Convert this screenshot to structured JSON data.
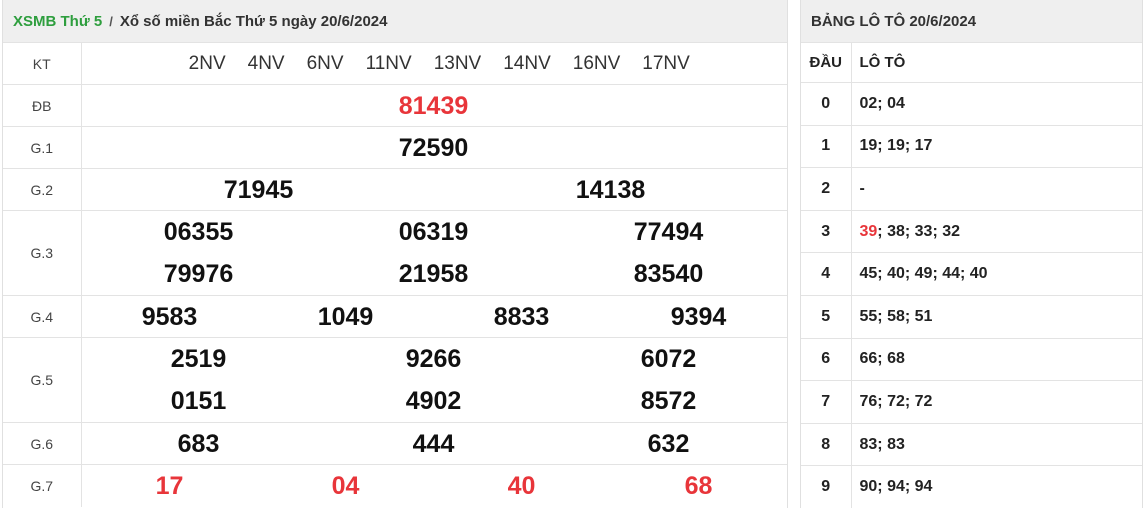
{
  "header": {
    "link_text": "XSMB Thứ 5",
    "separator": "/",
    "title": "Xổ số miền Bắc Thứ 5 ngày 20/6/2024"
  },
  "kt": {
    "label": "KT",
    "codes": [
      "2NV",
      "4NV",
      "6NV",
      "11NV",
      "13NV",
      "14NV",
      "16NV",
      "17NV"
    ]
  },
  "prizes": {
    "db": {
      "label": "ĐB",
      "numbers": [
        "81439"
      ]
    },
    "g1": {
      "label": "G.1",
      "numbers": [
        "72590"
      ]
    },
    "g2": {
      "label": "G.2",
      "numbers": [
        "71945",
        "14138"
      ]
    },
    "g3": {
      "label": "G.3",
      "numbers": [
        "06355",
        "06319",
        "77494",
        "79976",
        "21958",
        "83540"
      ]
    },
    "g4": {
      "label": "G.4",
      "numbers": [
        "9583",
        "1049",
        "8833",
        "9394"
      ]
    },
    "g5": {
      "label": "G.5",
      "numbers": [
        "2519",
        "9266",
        "6072",
        "0151",
        "4902",
        "8572"
      ]
    },
    "g6": {
      "label": "G.6",
      "numbers": [
        "683",
        "444",
        "632"
      ]
    },
    "g7": {
      "label": "G.7",
      "numbers": [
        "17",
        "04",
        "40",
        "68"
      ]
    }
  },
  "loto": {
    "title": "BẢNG LÔ TÔ 20/6/2024",
    "col_dau": "ĐẦU",
    "col_loto": "LÔ TÔ",
    "rows": [
      {
        "dau": "0",
        "highlight": "",
        "rest": "02; 04"
      },
      {
        "dau": "1",
        "highlight": "",
        "rest": "19; 19; 17"
      },
      {
        "dau": "2",
        "highlight": "",
        "rest": "-"
      },
      {
        "dau": "3",
        "highlight": "39",
        "rest": "; 38; 33; 32"
      },
      {
        "dau": "4",
        "highlight": "",
        "rest": "45; 40; 49; 44; 40"
      },
      {
        "dau": "5",
        "highlight": "",
        "rest": "55; 58; 51"
      },
      {
        "dau": "6",
        "highlight": "",
        "rest": "66; 68"
      },
      {
        "dau": "7",
        "highlight": "",
        "rest": "76; 72; 72"
      },
      {
        "dau": "8",
        "highlight": "",
        "rest": "83; 83"
      },
      {
        "dau": "9",
        "highlight": "",
        "rest": "90; 94; 94"
      }
    ]
  },
  "colors": {
    "accent_green": "#2e9e3e",
    "highlight_red": "#e8353a"
  }
}
